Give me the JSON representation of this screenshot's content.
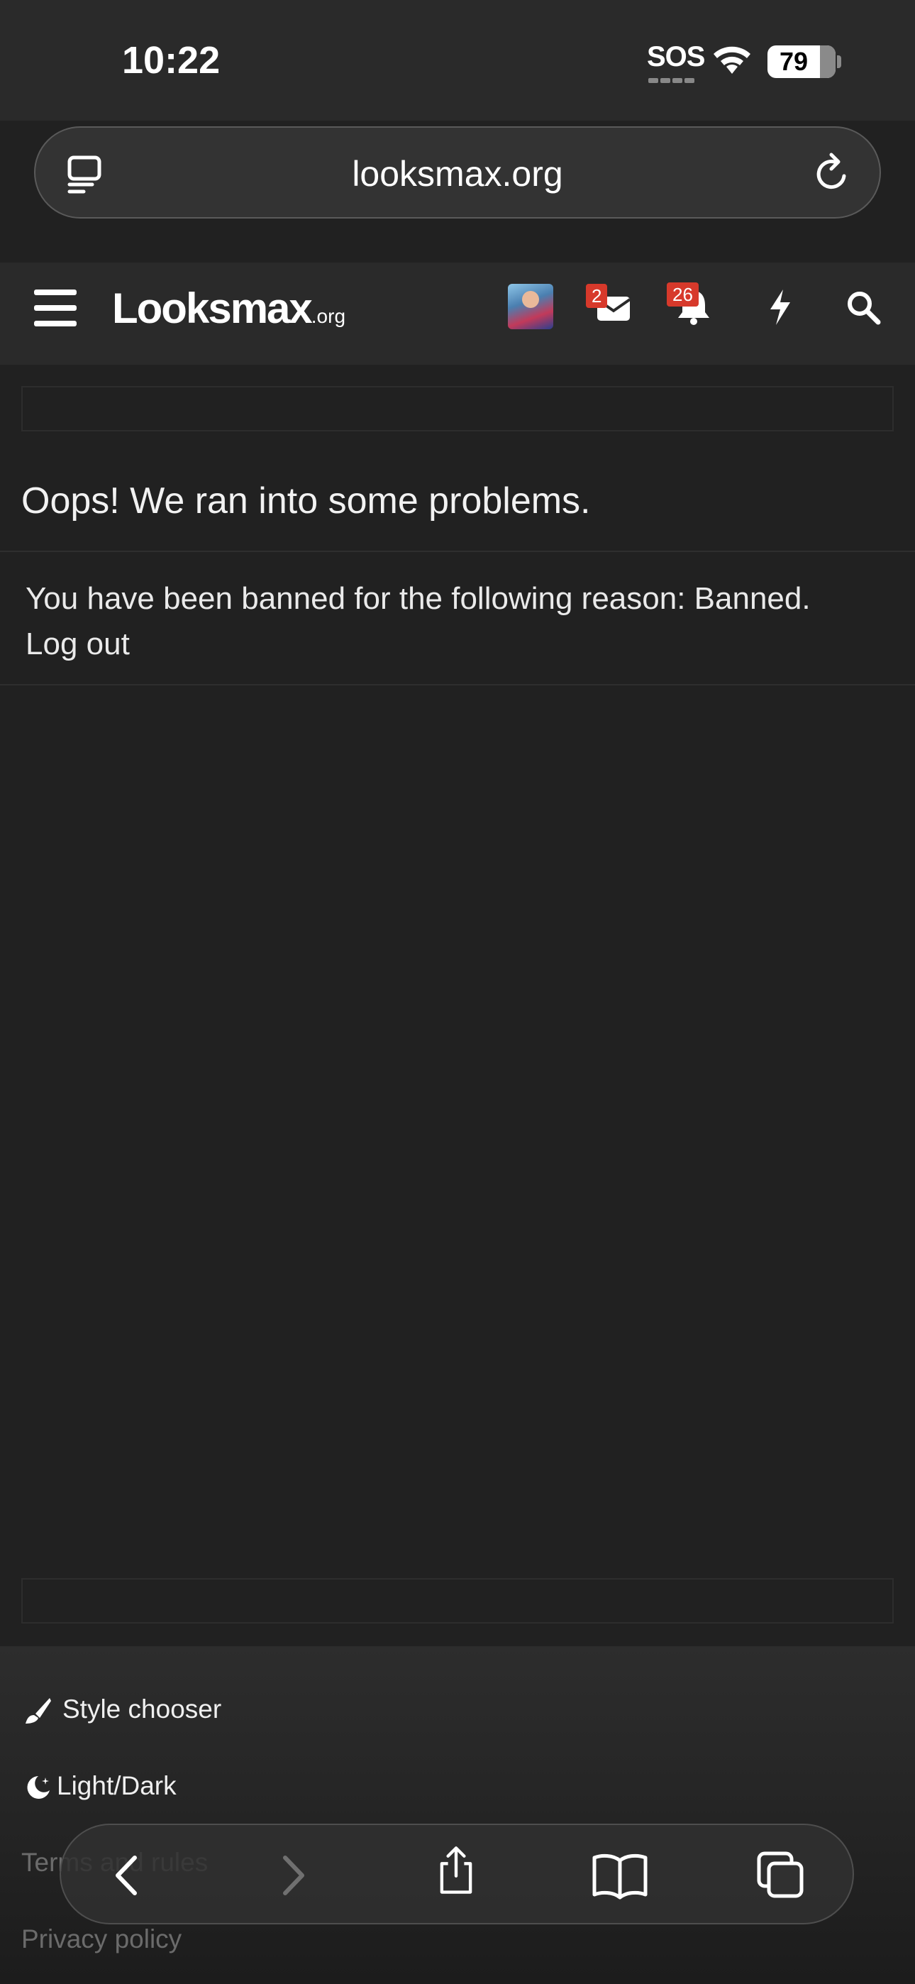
{
  "status_bar": {
    "time": "10:22",
    "sos": "SOS",
    "battery": "79"
  },
  "url_bar": {
    "url": "looksmax.org"
  },
  "site_header": {
    "logo_main": "Looksmax",
    "logo_suffix": ".org",
    "conversations_badge": "2",
    "alerts_badge": "26"
  },
  "main": {
    "title": "Oops! We ran into some problems.",
    "ban_message": "You have been banned for the following reason: Banned.",
    "logout_label": "Log out"
  },
  "footer": {
    "style_chooser": "Style chooser",
    "light_dark": "Light/Dark",
    "terms": "Terms and rules",
    "privacy": "Privacy policy"
  },
  "colors": {
    "background": "#212121",
    "header": "#2a2a2a",
    "badge": "#d7392b"
  },
  "icons": [
    "tab-view-icon",
    "reload-icon",
    "hamburger-menu-icon",
    "envelope-icon",
    "bell-icon",
    "bolt-icon",
    "search-icon",
    "paintbrush-icon",
    "moon-icon",
    "back-icon",
    "forward-icon",
    "share-icon",
    "bookmarks-icon",
    "tabs-icon"
  ]
}
